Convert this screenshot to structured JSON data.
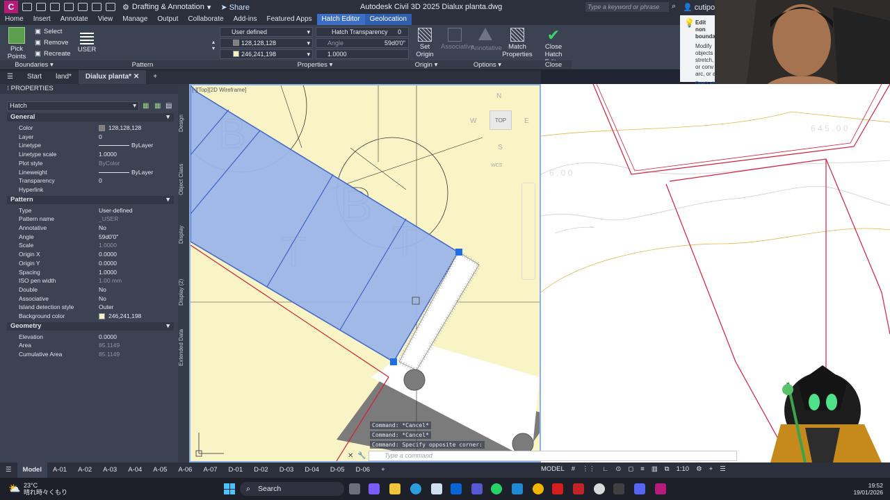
{
  "titlebar": {
    "app_letter": "C",
    "workspace": "Drafting & Annotation",
    "share": "Share",
    "app_title": "Autodesk Civil 3D 2025    Dialux planta.dwg",
    "search_placeholder": "Type a keyword or phrase",
    "user": "cutipo.e"
  },
  "ribbon_tabs": [
    "Home",
    "Insert",
    "Annotate",
    "View",
    "Manage",
    "Output",
    "Collaborate",
    "Add-ins",
    "Featured Apps",
    "Hatch Editor",
    "Geolocation"
  ],
  "ribbon": {
    "boundaries": {
      "title": "Boundaries",
      "pick_points": "Pick Points",
      "select": "Select",
      "remove": "Remove",
      "recreate": "Recreate"
    },
    "pattern": {
      "title": "Pattern",
      "user": "USER"
    },
    "properties": {
      "title": "Properties",
      "hatch_type": "User defined",
      "hatch_transparency_label": "Hatch Transparency",
      "hatch_transparency_value": "0",
      "color": "128,128,128",
      "angle_label": "Angle",
      "angle_value": "59d0'0\"",
      "background": "246,241,198",
      "scale_value": "1.0000"
    },
    "origin": {
      "title": "Origin",
      "set_origin": "Set Origin"
    },
    "options": {
      "title": "Options",
      "associative": "Associative",
      "annotative": "Annotative",
      "match_properties": "Match Properties"
    },
    "close": {
      "title": "Close",
      "close_hatch_editor": "Close Hatch Editor"
    }
  },
  "file_tabs": [
    "Start",
    "land*",
    "Dialux planta*"
  ],
  "properties_palette": {
    "header": "PROPERTIES",
    "selected": "Hatch",
    "sections": [
      {
        "name": "General",
        "rows": [
          {
            "k": "Color",
            "v": "128,128,128"
          },
          {
            "k": "Layer",
            "v": "0"
          },
          {
            "k": "Linetype",
            "v": "ByLayer"
          },
          {
            "k": "Linetype scale",
            "v": "1.0000"
          },
          {
            "k": "Plot style",
            "v": "ByColor"
          },
          {
            "k": "Lineweight",
            "v": "ByLayer"
          },
          {
            "k": "Transparency",
            "v": "0"
          },
          {
            "k": "Hyperlink",
            "v": ""
          }
        ]
      },
      {
        "name": "Pattern",
        "rows": [
          {
            "k": "Type",
            "v": "User-defined"
          },
          {
            "k": "Pattern name",
            "v": "_USER"
          },
          {
            "k": "Annotative",
            "v": "No"
          },
          {
            "k": "Angle",
            "v": "59d0'0\""
          },
          {
            "k": "Scale",
            "v": "1.0000"
          },
          {
            "k": "Origin X",
            "v": "0.0000"
          },
          {
            "k": "Origin Y",
            "v": "0.0000"
          },
          {
            "k": "Spacing",
            "v": "1.0000"
          },
          {
            "k": "ISO pen width",
            "v": "1.00 mm"
          },
          {
            "k": "Double",
            "v": "No"
          },
          {
            "k": "Associative",
            "v": "No"
          },
          {
            "k": "Island detection style",
            "v": "Outer"
          },
          {
            "k": "Background color",
            "v": "246,241,198"
          }
        ]
      },
      {
        "name": "Geometry",
        "rows": [
          {
            "k": "Elevation",
            "v": "0.0000"
          },
          {
            "k": "Area",
            "v": "85.1149"
          },
          {
            "k": "Cumulative Area",
            "v": "85.1149"
          }
        ]
      }
    ],
    "vertical_tabs": [
      "Design",
      "Object Class",
      "Display",
      "Display (2)",
      "Extended Data"
    ]
  },
  "viewport": {
    "label": "[-][Top][2D Wireframe]",
    "viewcube": {
      "top": "TOP",
      "n": "N",
      "s": "S",
      "e": "E",
      "w": "W",
      "wcs": "WCS"
    }
  },
  "command": {
    "history": [
      "Command: *Cancel*",
      "Command: *Cancel*",
      "Command: Specify opposite corner:"
    ],
    "placeholder": "Type a command"
  },
  "layout_tabs": [
    "Model",
    "A-01",
    "A-02",
    "A-03",
    "A-04",
    "A-05",
    "A-06",
    "A-07",
    "D-01",
    "D-02",
    "D-03",
    "D-04",
    "D-05",
    "D-06"
  ],
  "status": {
    "model": "MODEL",
    "scale": "1:10"
  },
  "taskbar": {
    "temp": "23°C",
    "weather": "晴れ時々くもり",
    "search": "Search",
    "time": "19:52",
    "date": "19/01/2026"
  },
  "tooltip": {
    "title": "Edit non boundary",
    "body": "Modify objects stretch, or conv arc, or a",
    "link": "Don't sh"
  },
  "colors": {
    "accent": "#3c6fc4",
    "hatch_fill": "#9db6e8",
    "background_hatch": "#f8f4c6",
    "boundary_red": "#d21e3c"
  }
}
